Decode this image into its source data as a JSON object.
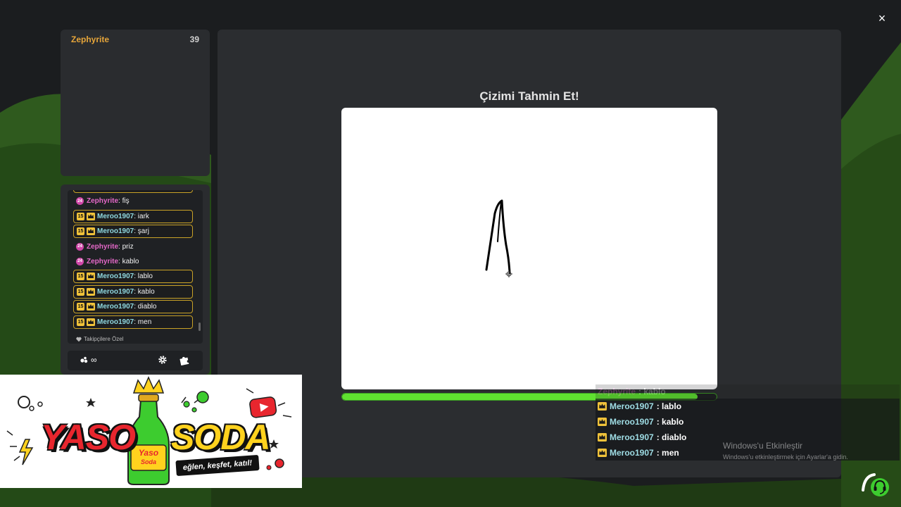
{
  "window": {
    "close_label": "×"
  },
  "player": {
    "name": "Zephyrite",
    "score": "39"
  },
  "chat": {
    "messages": [
      {
        "user": "Zephyrite",
        "text": ": fiş",
        "kind": "streamer",
        "badge": "24"
      },
      {
        "user": "Meroo1907",
        "text": ": iark",
        "kind": "vip",
        "level": "15"
      },
      {
        "user": "Meroo1907",
        "text": ": şarj",
        "kind": "vip",
        "level": "15"
      },
      {
        "user": "Zephyrite",
        "text": ": priz",
        "kind": "streamer",
        "badge": "24"
      },
      {
        "user": "Zephyrite",
        "text": ": kablo",
        "kind": "streamer",
        "badge": "24"
      },
      {
        "user": "Meroo1907",
        "text": ": lablo",
        "kind": "vip",
        "level": "15"
      },
      {
        "user": "Meroo1907",
        "text": ": kablo",
        "kind": "vip",
        "level": "15"
      },
      {
        "user": "Meroo1907",
        "text": ": diablo",
        "kind": "vip",
        "level": "15"
      },
      {
        "user": "Meroo1907",
        "text": ": men",
        "kind": "vip",
        "level": "15"
      }
    ],
    "followers_only": "Takipçilere Özel",
    "coins": "∞"
  },
  "game": {
    "title": "Çizimi Tahmin Et!",
    "progress_fraction": 0.95
  },
  "overlay_chat": [
    {
      "user": "Zephyrite",
      "text": ": kablo",
      "faded": true
    },
    {
      "user": "Meroo1907",
      "text": ": lablo",
      "faded": false
    },
    {
      "user": "Meroo1907",
      "text": ": kablo",
      "faded": false
    },
    {
      "user": "Meroo1907",
      "text": ": diablo",
      "faded": false
    },
    {
      "user": "Meroo1907",
      "text": ": men",
      "faded": false
    }
  ],
  "windows_activation": {
    "title": "Windows'u Etkinleştir",
    "subtitle": "Windows'u etkinleştirmek için Ayarlar'a gidin."
  },
  "banner": {
    "brand_left": "YASO",
    "brand_right": "SODA",
    "bottle_label_top": "Yaso",
    "bottle_label_bottom": "Soda",
    "tagline": "eğlen, keşfet, katıl!"
  },
  "colors": {
    "accent_green": "#5fe130",
    "player_name": "#e6a53a",
    "vip_border": "#c9a227",
    "streamer_pink": "#e468c8",
    "viewer_teal": "#8fd8e0"
  },
  "icons": [
    "close-icon",
    "crown-icon",
    "heart-icon",
    "gear-icon",
    "puzzle-icon",
    "coin-icon",
    "headset-support-icon",
    "youtube-icon",
    "star-icon",
    "lightning-icon"
  ]
}
